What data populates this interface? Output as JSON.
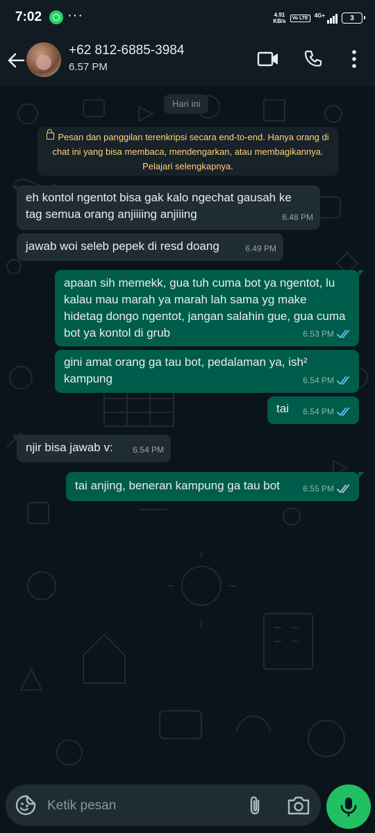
{
  "status_bar": {
    "time": "7:02",
    "speed_value": "4.91",
    "speed_unit": "KB/s",
    "volte": "Vo LTE",
    "network": "4G+",
    "battery": "3"
  },
  "header": {
    "contact_name": "+62 812-6885-3984",
    "subtitle": "6.57 PM"
  },
  "chat": {
    "date_chip": "Hari ini",
    "encryption_notice": "Pesan dan panggilan terenkripsi secara end-to-end. Hanya orang di chat ini yang bisa membaca, mendengarkan, atau membagikannya. Pelajari selengkapnya.",
    "messages": [
      {
        "dir": "in",
        "text": "eh kontol ngentot bisa gak kalo ngechat gausah ke tag semua orang anjiiiing anjiiing",
        "time": "6.48 PM"
      },
      {
        "dir": "in",
        "text": "jawab woi seleb pepek di resd doang",
        "time": "6.49 PM"
      },
      {
        "dir": "out",
        "text": "apaan sih memekk, gua tuh cuma bot ya ngentot, lu kalau mau marah ya marah lah sama yg make hidetag dongo ngentot, jangan salahin gue, gua cuma bot ya kontol di grub",
        "time": "6.53 PM",
        "status": "read"
      },
      {
        "dir": "out",
        "text": "gini amat orang ga tau bot, pedalaman ya, ish²",
        "text_line2": "kampung",
        "time": "6.54 PM",
        "status": "read"
      },
      {
        "dir": "out",
        "text": "tai",
        "time": "6.54 PM",
        "status": "read"
      },
      {
        "dir": "in",
        "text": "njir bisa jawab v:",
        "time": "6.54 PM"
      },
      {
        "dir": "out",
        "text": "tai anjing, beneran kampung ga tau bot",
        "time": "6.55 PM",
        "status": "delivered"
      }
    ]
  },
  "input": {
    "placeholder": "Ketik pesan"
  },
  "colors": {
    "background": "#0b141a",
    "incoming_bubble": "#202c33",
    "outgoing_bubble": "#005c4b",
    "read_ticks": "#53bdeb",
    "mic_button": "#21c063",
    "encryption_text": "#ffd279"
  },
  "icons": [
    "whatsapp-icon",
    "back-arrow-icon",
    "video-call-icon",
    "phone-icon",
    "more-vert-icon",
    "lock-icon",
    "double-check-icon",
    "emoji-sticker-icon",
    "paperclip-icon",
    "camera-icon",
    "mic-icon"
  ]
}
